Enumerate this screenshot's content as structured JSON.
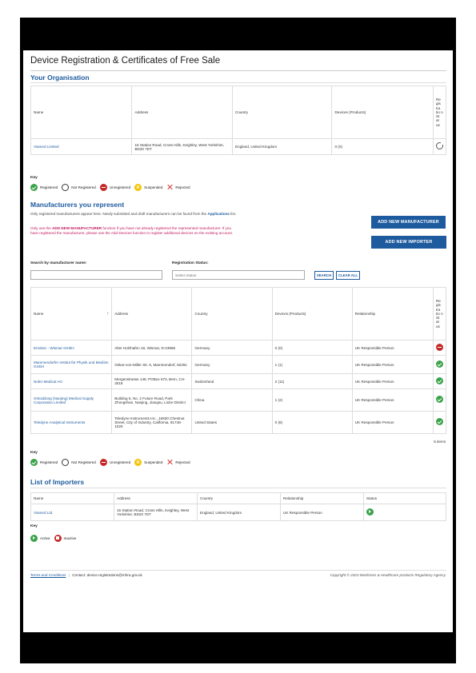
{
  "page": {
    "title": "Device Registration & Certificates of Free Sale"
  },
  "organisation": {
    "heading": "Your Organisation",
    "columns": {
      "name": "Name",
      "address": "Address",
      "country": "Country",
      "devices": "Devices (Products)",
      "status": "Re gis tra tio n St at us"
    },
    "row": {
      "name": "Viamed Limited",
      "address": "15 Station Road, Cross Hills, Keighley, West Yorkshire, BD20 7DT",
      "country": "England, United Kingdom",
      "devices": "0 (0)",
      "status_icon": "pending-icon"
    }
  },
  "key": {
    "title": "Key",
    "items": [
      {
        "label": "Registered",
        "icon": "registered-icon"
      },
      {
        "label": "Not Registered",
        "icon": "not-registered-icon"
      },
      {
        "label": "Unregistered",
        "icon": "unregistered-icon"
      },
      {
        "label": "Suspended",
        "icon": "suspended-icon"
      },
      {
        "label": "Rejected",
        "icon": "rejected-icon"
      }
    ]
  },
  "manufacturers": {
    "heading": "Manufacturers you represent",
    "info_prefix": "Only registered manufacturers appear here. Newly submitted and draft manufacturers can be found from the",
    "info_link": "Applications",
    "info_suffix": "list.",
    "warn_prefix": "Only use the",
    "warn_bold": "ADD NEW MANUFACTURER",
    "warn_suffix": "function if you have not already registered the represented manufacturer. If you have registered the manufacturer, please use the Add Devices function to register additional devices on the existing account.",
    "add_manufacturer_label": "ADD NEW MANUFACTURER",
    "add_importer_label": "ADD NEW IMPORTER",
    "search_label": "Search by manufacturer name:",
    "search_value": "",
    "status_label": "Registration Status:",
    "status_placeholder": "Select status",
    "search_button": "SEARCH",
    "clear_button": "CLEAR ALL",
    "columns": {
      "name": "Name",
      "address": "Address",
      "country": "Country",
      "devices": "Devices (Products)",
      "relationship": "Relationship",
      "status": "Re gis tra tio n St at us"
    },
    "rows": [
      {
        "name": "Emvitec - Wismar GmbH",
        "address": "Alter Holzhafen 18, Wismar, D-23966",
        "country": "Germany",
        "devices": "0 (0)",
        "relationship": "UK Responsible Person",
        "status": "unregistered"
      },
      {
        "name": "Mammendorfer Institut für Physik und Medizin GmbH",
        "address": "Oskar-von-Miller Str. 6, Mammendorf, 82291",
        "country": "Germany",
        "devices": "1 (1)",
        "relationship": "UK Responsible Person",
        "status": "registered"
      },
      {
        "name": "Nufer Medical AG",
        "address": "Morgenstrasse 148, POBox 673, Bern, CH-3018",
        "country": "Switzerland",
        "devices": "2 (11)",
        "relationship": "UK Responsible Person",
        "status": "registered"
      },
      {
        "name": "Ontoddong (Nanjing) Medical Supply Corporation Limited",
        "address": "Building 5, No. 2 Future Road, Park Zhongshan, Nanjing, Jiangsu, Liuhe District",
        "country": "China",
        "devices": "1 (2)",
        "relationship": "UK Responsible Person",
        "status": "registered"
      },
      {
        "name": "Teledyne Analytical Instruments",
        "address": "Teledyne Instruments Inc., 16830 Chestnut Street, City of Industry, California, 91748-1020",
        "country": "United States",
        "devices": "0 (8)",
        "relationship": "UK Responsible Person",
        "status": "registered"
      }
    ],
    "items_count": "5 items"
  },
  "importers": {
    "heading": "List of Importers",
    "columns": {
      "name": "Name",
      "address": "Address",
      "country": "Country",
      "relationship": "Relationship",
      "status": "Status"
    },
    "row": {
      "name": "Viamed Ltd.",
      "address": "15 Station Road, Cross Hills, Keighley, West Yorkshire, BD20 7DT",
      "country": "England, United Kingdom",
      "relationship": "UK Responsible Person",
      "status": "active"
    },
    "key_title": "Key",
    "key_items": [
      {
        "label": "Active",
        "icon": "active-icon"
      },
      {
        "label": "Inactive",
        "icon": "inactive-icon"
      }
    ]
  },
  "footer": {
    "terms": "Terms and Conditions",
    "separator": "|",
    "contact": "Contact: device.registrations@mhra.gov.uk",
    "copyright": "Copyright © 2023 Medicines & Healthcare products Regulatory Agency"
  },
  "colors": {
    "brand_blue": "#1d5a9e",
    "registered_green": "#3aa34a",
    "unregistered_red": "#c62828",
    "suspended_yellow": "#f3c300",
    "warning_text": "#c2185b"
  }
}
